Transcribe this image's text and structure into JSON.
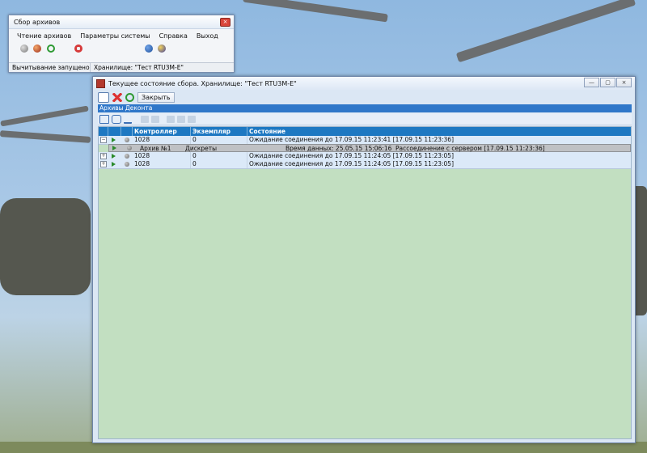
{
  "small_window": {
    "title": "Сбор архивов",
    "close_glyph": "×",
    "menu": [
      "Чтение архивов",
      "Параметры системы",
      "Справка",
      "Выход"
    ],
    "toolbar_icons": [
      "stop-icon",
      "pause-icon",
      "refresh-icon",
      "disconnect-icon",
      "connect-icon",
      "key-icon"
    ],
    "status": [
      "Вычитывание запущено",
      "Хранилище: \"Тест RTU3M-E\""
    ]
  },
  "main_window": {
    "title": "Текущее состояние сбора. Хранилище: \"Тест RTU3M-E\"",
    "buttons": {
      "minimize": "—",
      "maximize": "▢",
      "close": "×"
    },
    "close_button": "Закрыть",
    "panel_title": "Архивы Деконта",
    "columns": [
      "Контроллер",
      "Экземпляр",
      "Состояние"
    ],
    "rows": [
      {
        "controller": "1028",
        "instance": "0",
        "state": "Ожидание соединения до 17.09.15 11:23:41 [17.09.15 11:23:36]",
        "expander": "−"
      },
      {
        "controller": "1028",
        "instance": "0",
        "state": "Ожидание соединения до 17.09.15 11:24:05 [17.09.15 11:23:05]",
        "expander": "+"
      },
      {
        "controller": "1028",
        "instance": "0",
        "state": "Ожидание соединения до 17.09.15 11:24:05 [17.09.15 11:23:05]",
        "expander": "+"
      }
    ],
    "sub_row": {
      "archive": "Архив №1",
      "type": "Дискреты",
      "data_time": "Время данных: 25.05.15 15:06:16",
      "disconnect": "Рассоединение с сервером [17.09.15 11:23:36]"
    }
  },
  "colors": {
    "accent": "#2f77c9",
    "grid_bg": "#c2dfc1",
    "header": "#1d78c2"
  }
}
